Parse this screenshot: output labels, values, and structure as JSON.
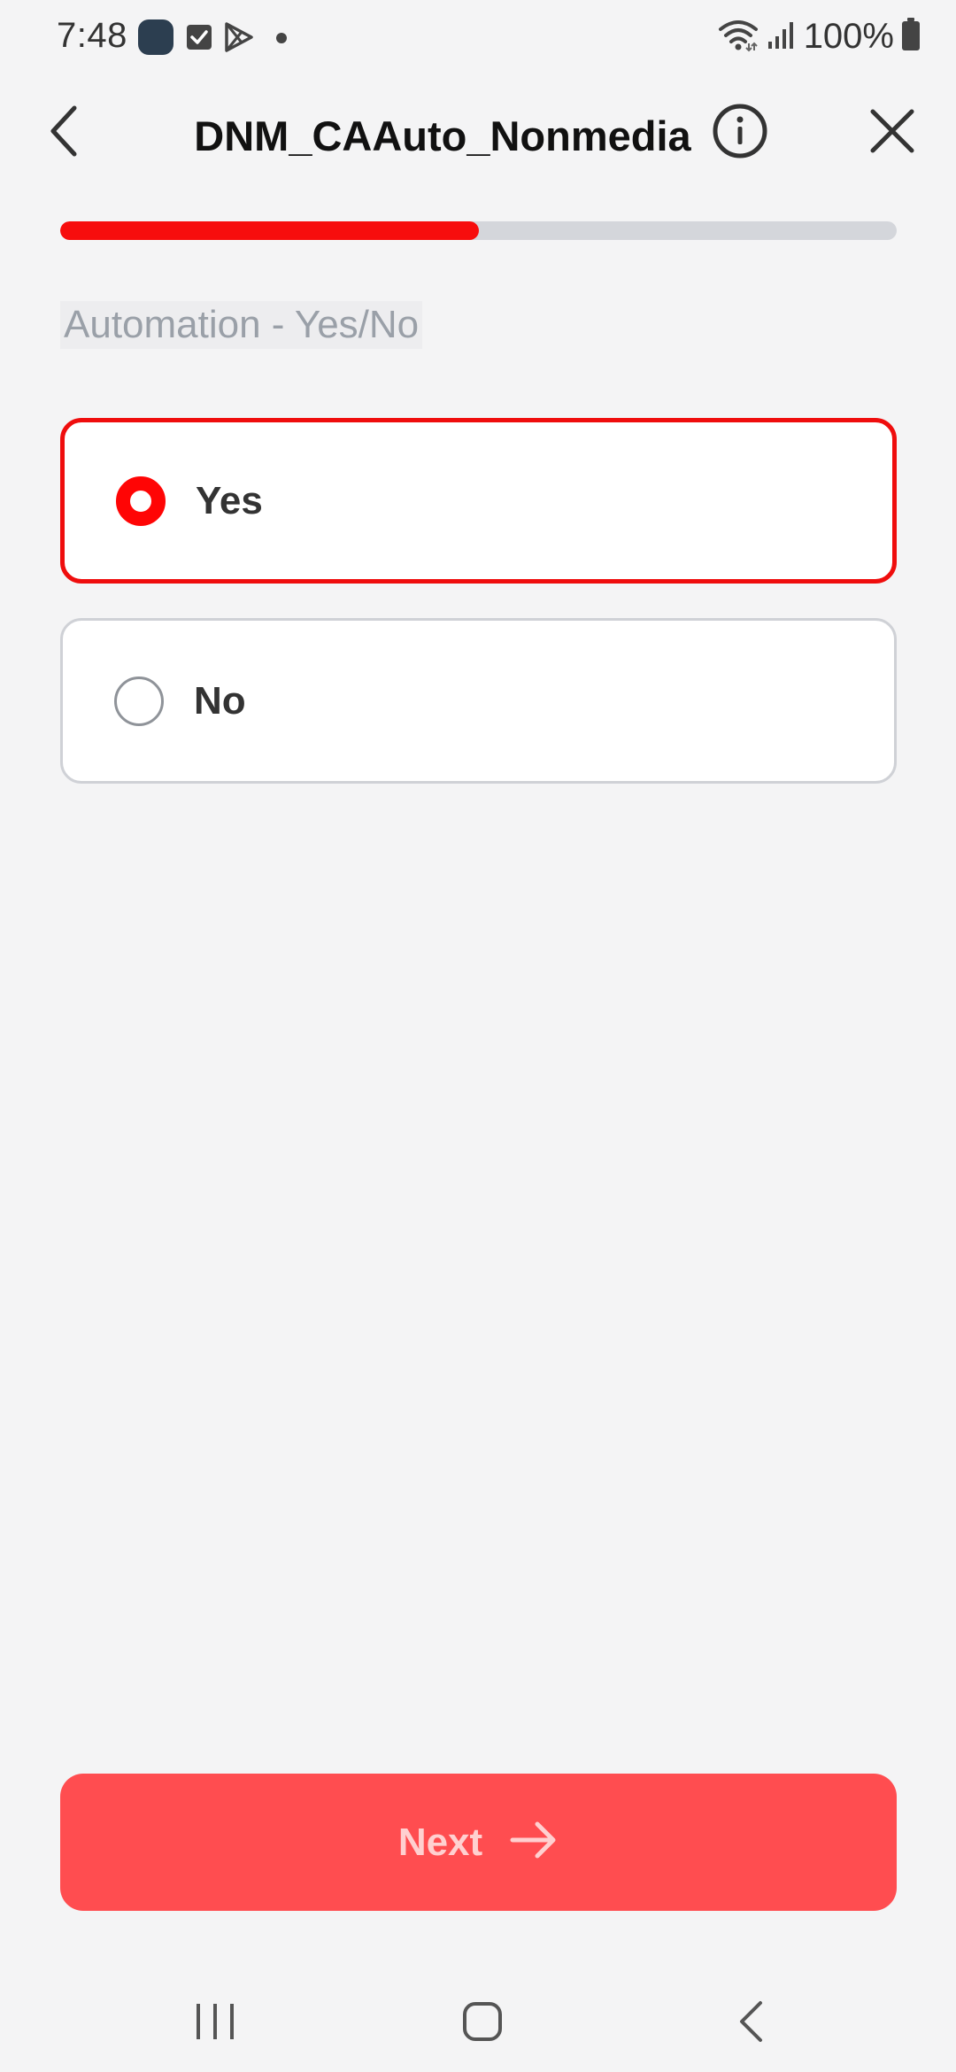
{
  "status_bar": {
    "time": "7:48",
    "battery": "100%",
    "icons": [
      "app-notification-icon",
      "checkbox-notification-icon",
      "play-store-icon",
      "more-notifications-dot",
      "wifi-icon",
      "signal-icon",
      "battery-icon"
    ]
  },
  "header": {
    "title": "DNM_CAAuto_Nonmedia",
    "back_icon": "chevron-left-icon",
    "info_icon": "info-icon",
    "close_icon": "close-icon"
  },
  "progress": {
    "value": 0.5
  },
  "question": {
    "label": "Automation - Yes/No"
  },
  "options": [
    {
      "label": "Yes",
      "selected": true
    },
    {
      "label": "No",
      "selected": false
    }
  ],
  "next_button": {
    "label": "Next",
    "icon": "arrow-right-icon"
  },
  "nav_bar": {
    "icons": [
      "recents-icon",
      "home-icon",
      "back-icon"
    ]
  },
  "colors": {
    "accent": "#ff0505",
    "next_button_bg": "#ff4d50",
    "progress_track": "#d4d6db",
    "background": "#f4f4f5"
  }
}
